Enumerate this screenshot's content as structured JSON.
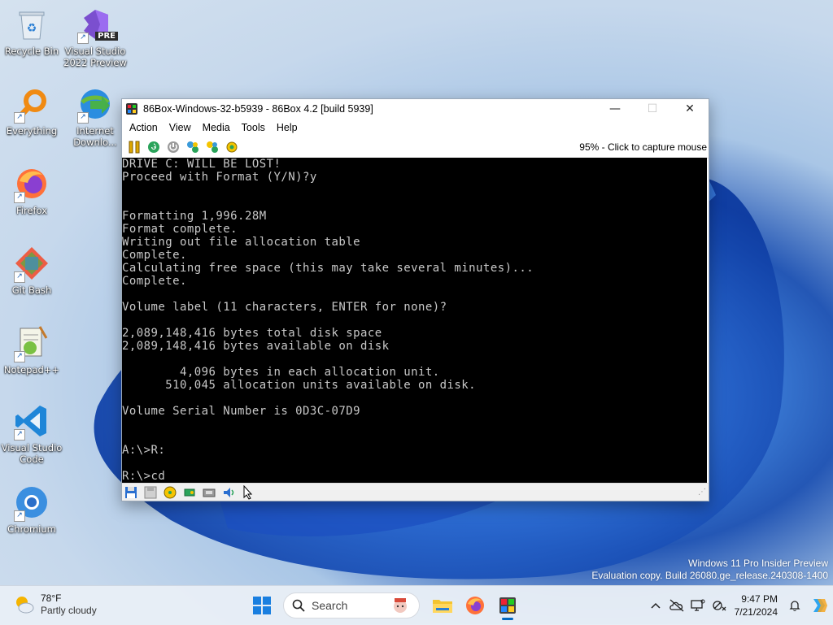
{
  "desktop": {
    "icons": [
      {
        "label": "Recycle Bin",
        "icon": "recycle-bin-icon"
      },
      {
        "label": "Visual Studio 2022 Preview",
        "badge": "PRE",
        "icon": "visual-studio-icon"
      },
      {
        "label": "Everything",
        "icon": "everything-search-icon"
      },
      {
        "label": "Internet Downlo...",
        "icon": "internet-download-manager-icon"
      },
      {
        "label": "Firefox",
        "icon": "firefox-icon"
      },
      {
        "label": "Git Bash",
        "icon": "git-bash-icon"
      },
      {
        "label": "Notepad++",
        "icon": "notepadpp-icon"
      },
      {
        "label": "Visual Studio Code",
        "icon": "vscode-icon"
      },
      {
        "label": "Chromium",
        "icon": "chromium-icon"
      }
    ]
  },
  "window": {
    "title": "86Box-Windows-32-b5939 - 86Box 4.2 [build 5939]",
    "controls": {
      "minimize": "—",
      "maximize": "☐",
      "close": "✕"
    },
    "menu": [
      "Action",
      "View",
      "Media",
      "Tools",
      "Help"
    ],
    "toolbar_status": "95% - Click to capture mouse",
    "screen_lines": [
      "DRIVE C: WILL BE LOST!",
      "Proceed with Format (Y/N)?y",
      "",
      "",
      "Formatting 1,996.28M",
      "Format complete.",
      "Writing out file allocation table",
      "Complete.",
      "Calculating free space (this may take several minutes)...",
      "Complete.",
      "",
      "Volume label (11 characters, ENTER for none)?",
      "",
      "2,089,148,416 bytes total disk space",
      "2,089,148,416 bytes available on disk",
      "",
      "        4,096 bytes in each allocation unit.",
      "      510,045 allocation units available on disk.",
      "",
      "Volume Serial Number is 0D3C-07D9",
      "",
      "",
      "A:\\>R:",
      "",
      "R:\\>cd"
    ]
  },
  "watermark": {
    "line1": "Windows 11 Pro Insider Preview",
    "line2": "Evaluation copy. Build 26080.ge_release.240308-1400"
  },
  "taskbar": {
    "weather_temp": "78°F",
    "weather_cond": "Partly cloudy",
    "search_placeholder": "Search",
    "time": "9:47 PM",
    "date": "7/21/2024"
  },
  "colors": {
    "accent": "#0067c0",
    "console_bg": "#000000",
    "console_fg": "#c8c8c8"
  }
}
